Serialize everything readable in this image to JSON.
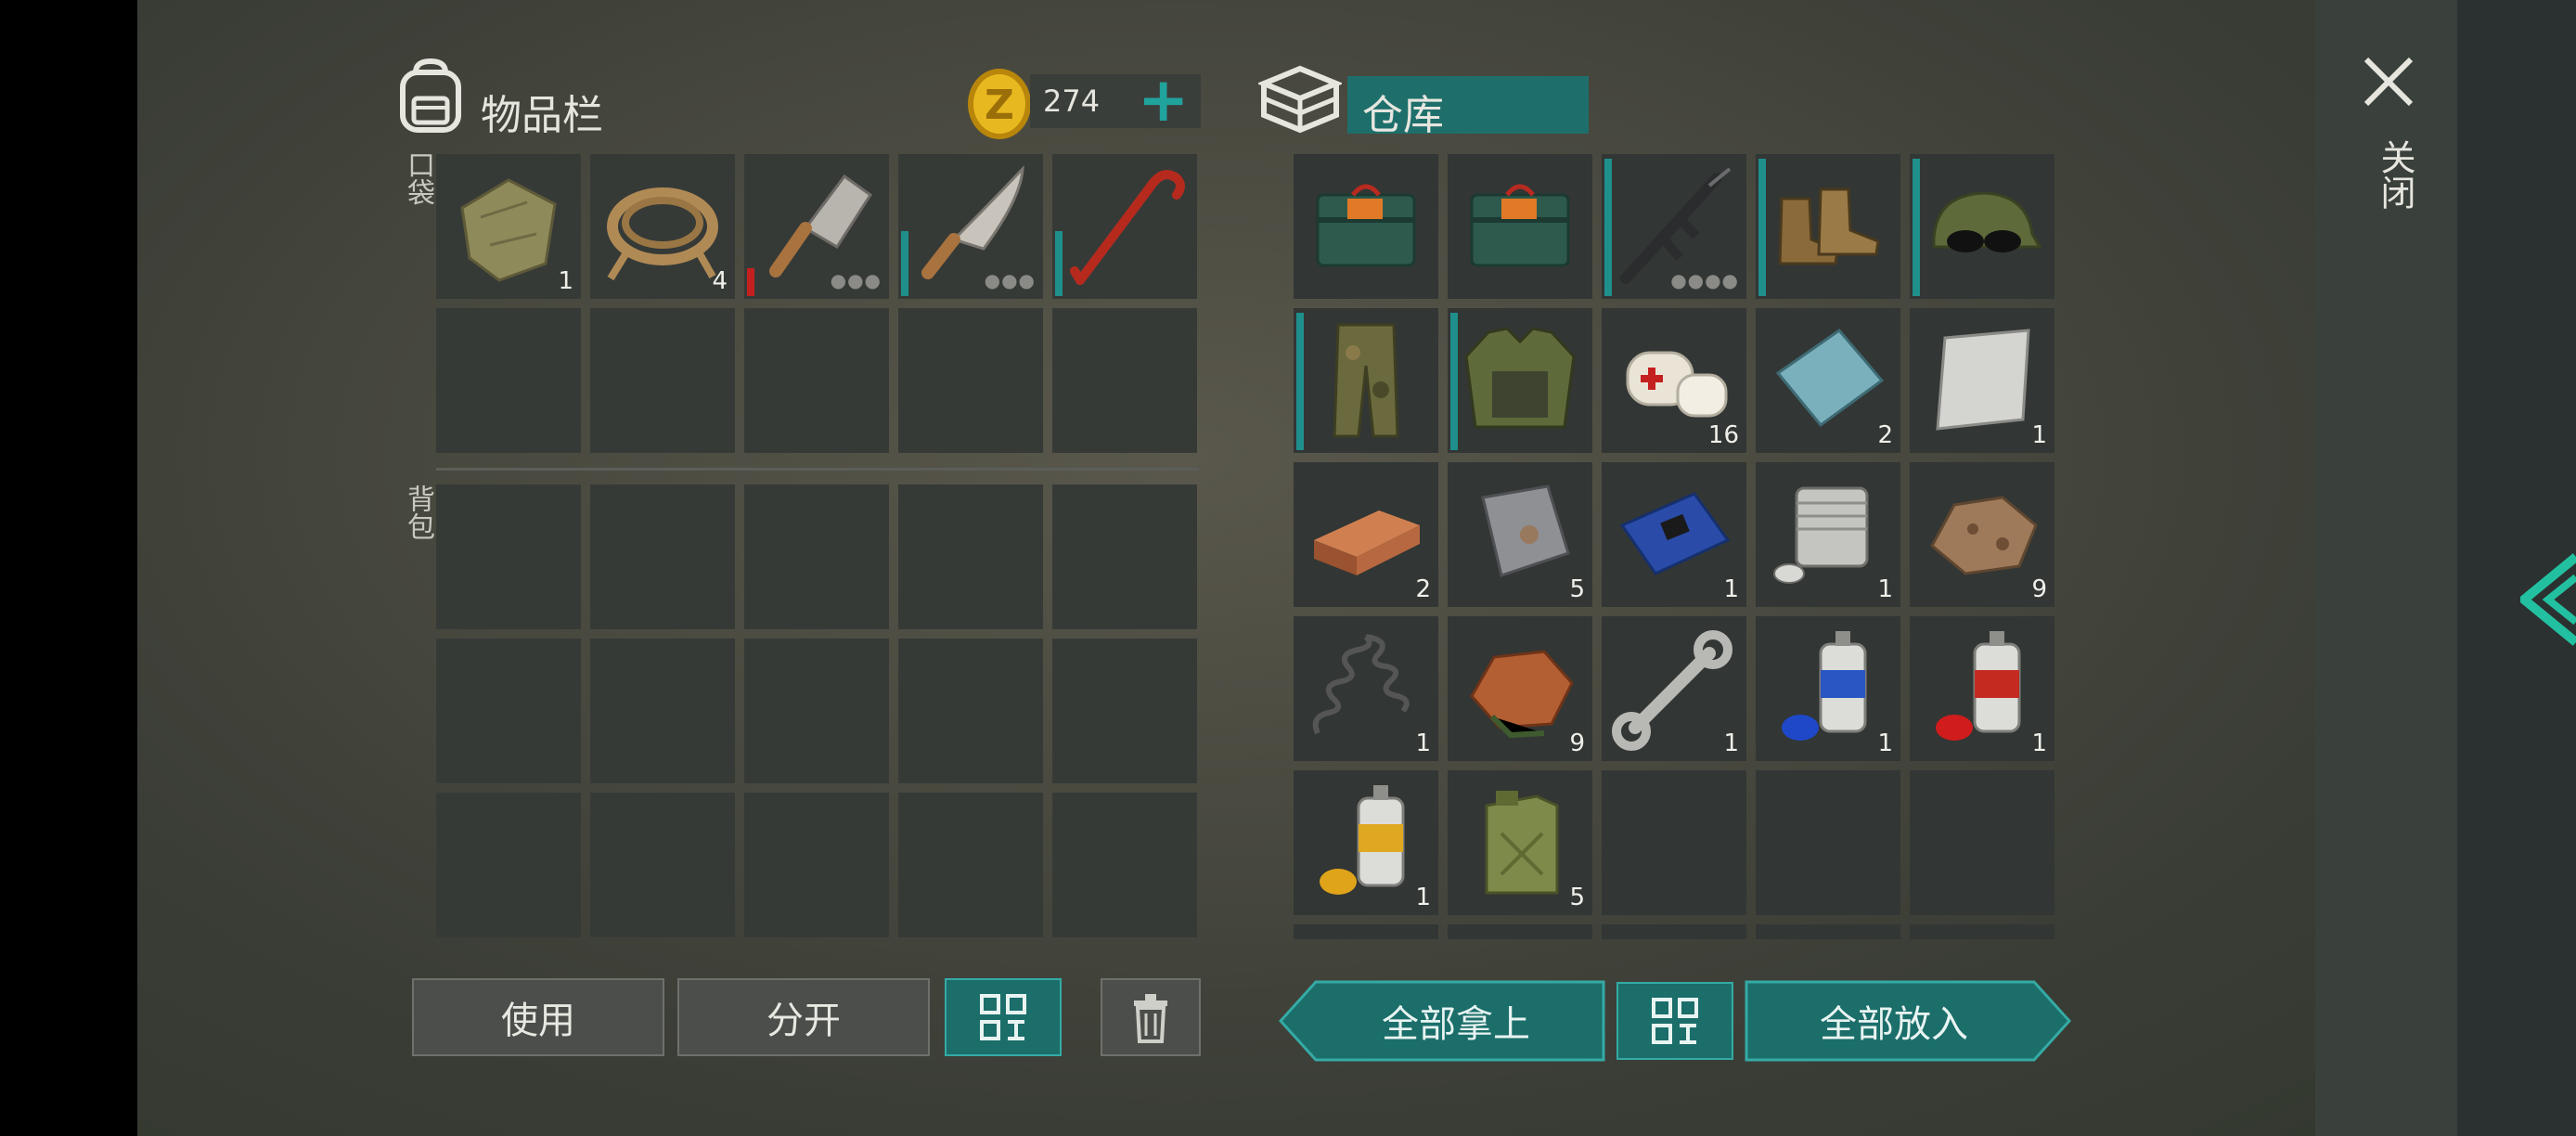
{
  "inventory": {
    "title": "物品栏",
    "coins": "274",
    "add_coins_symbol": "+",
    "pocket_label": "口袋",
    "backpack_label": "背包",
    "pocket_items": [
      {
        "name": "cloth-rag",
        "count": "1"
      },
      {
        "name": "rope",
        "count": "4"
      },
      {
        "name": "cleaver",
        "count": "",
        "durability": "low"
      },
      {
        "name": "machete",
        "count": ""
      },
      {
        "name": "crowbar",
        "count": ""
      }
    ]
  },
  "storage": {
    "title": "仓库",
    "items": [
      {
        "name": "ammo-box",
        "count": ""
      },
      {
        "name": "ammo-box",
        "count": ""
      },
      {
        "name": "assault-rifle",
        "count": ""
      },
      {
        "name": "boots",
        "count": ""
      },
      {
        "name": "cap-with-sunglasses",
        "count": ""
      },
      {
        "name": "camo-pants",
        "count": ""
      },
      {
        "name": "camo-vest",
        "count": ""
      },
      {
        "name": "bandage",
        "count": "16"
      },
      {
        "name": "glass-sheet",
        "count": "2"
      },
      {
        "name": "metal-sheet",
        "count": "1"
      },
      {
        "name": "copper-ingot",
        "count": "2"
      },
      {
        "name": "iron-plate",
        "count": "5"
      },
      {
        "name": "circuit-board",
        "count": "1"
      },
      {
        "name": "engine-cylinder",
        "count": "1"
      },
      {
        "name": "iron-ore",
        "count": "9"
      },
      {
        "name": "spring",
        "count": "1"
      },
      {
        "name": "copper-ore",
        "count": "9"
      },
      {
        "name": "wrench",
        "count": "1"
      },
      {
        "name": "blue-paint",
        "count": "1"
      },
      {
        "name": "red-paint",
        "count": "1"
      },
      {
        "name": "yellow-paint",
        "count": "1"
      },
      {
        "name": "jerrycan",
        "count": "5"
      }
    ]
  },
  "buttons": {
    "use": "使用",
    "split": "分开",
    "take_all": "全部拿上",
    "put_all": "全部放入",
    "close": "关闭"
  },
  "colors": {
    "accent_teal": "#1b6e6a",
    "coin_gold": "#e0b020",
    "durability_teal": "#1f8f8c",
    "durability_red": "#c42020"
  }
}
